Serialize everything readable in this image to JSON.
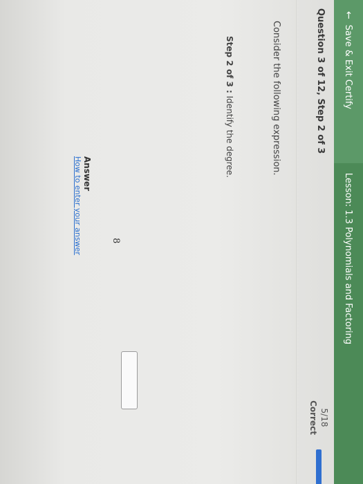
{
  "topbar": {
    "save_exit_label": "Save & Exit Certify",
    "lesson_title": "Lesson: 1.3 Polynomials and Factoring"
  },
  "question": {
    "label": "Question 3 of 12, Step 2 of 3",
    "score": "5/18",
    "score_status": "Correct",
    "progress_fraction": 0.28
  },
  "content": {
    "prompt": "Consider the following expression.",
    "expression": "8",
    "step_prefix": "Step 2 of 3 :",
    "step_text": "Identify the degree."
  },
  "answer": {
    "label": "Answer",
    "help_link": "How to enter your answer",
    "value": ""
  },
  "colors": {
    "topbar": "#4c8a57",
    "save_button": "#5c9968",
    "progress": "#2f6fd0",
    "link": "#2a6fcf"
  }
}
